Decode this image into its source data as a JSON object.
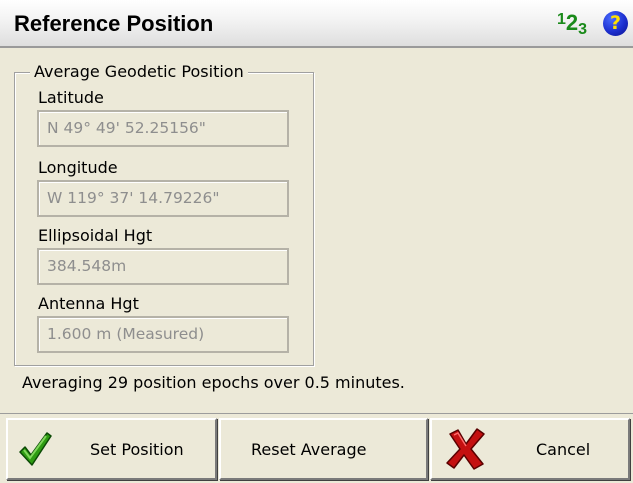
{
  "window": {
    "title": "Reference Position",
    "numeric_icon": {
      "d1": "1",
      "d2": "2",
      "d3": "3"
    },
    "help_glyph": "?"
  },
  "group": {
    "legend": "Average Geodetic Position",
    "fields": [
      {
        "label": "Latitude",
        "value": "N 49° 49' 52.25156\""
      },
      {
        "label": "Longitude",
        "value": "W 119° 37' 14.79226\""
      },
      {
        "label": "Ellipsoidal Hgt",
        "value": "384.548m"
      },
      {
        "label": "Antenna Hgt",
        "value": "1.600 m (Measured)"
      }
    ]
  },
  "status_text": "Averaging 29 position epochs over 0.5 minutes.",
  "buttons": {
    "set_position": "Set Position",
    "reset_average": "Reset Average",
    "cancel": "Cancel"
  },
  "icons": {
    "check": "checkmark-icon",
    "cross": "red-x-icon",
    "help": "help-icon",
    "numeric": "numeric-input-icon"
  },
  "colors": {
    "window_bg": "#ece9d8",
    "field_text": "#8e8e8e",
    "check_green": "#2e9c12",
    "cross_red": "#c41010",
    "help_blue": "#1c2fcf",
    "numeric_green": "#1a8a1a"
  }
}
